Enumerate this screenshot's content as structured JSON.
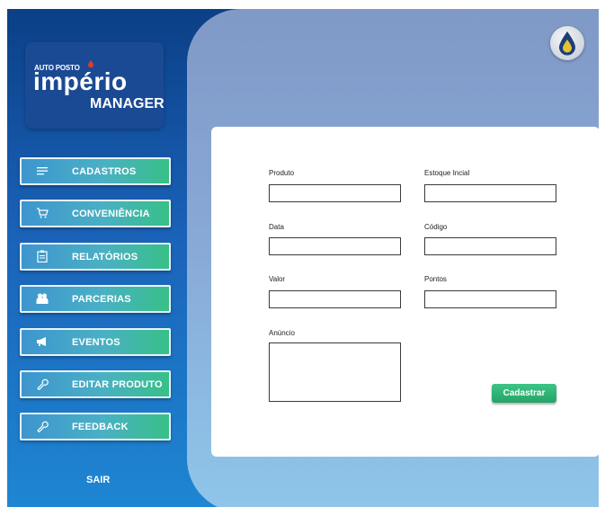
{
  "brand": {
    "logo_top": "AUTO POSTO",
    "logo_main": "império",
    "logo_sub": "MANAGER"
  },
  "sidebar": {
    "items": [
      {
        "label": "CADASTROS",
        "icon": "menu-lines-icon"
      },
      {
        "label": "CONVENIÊNCIA",
        "icon": "cart-icon"
      },
      {
        "label": "RELATÓRIOS",
        "icon": "clipboard-icon"
      },
      {
        "label": "PARCERIAS",
        "icon": "people-icon"
      },
      {
        "label": "EVENTOS",
        "icon": "megaphone-icon"
      },
      {
        "label": "EDITAR PRODUTO",
        "icon": "wrench-icon"
      },
      {
        "label": "FEEDBACK",
        "icon": "wrench-icon"
      }
    ],
    "logout_label": "SAIR"
  },
  "form": {
    "fields": {
      "produto": {
        "label": "Produto",
        "value": ""
      },
      "estoque": {
        "label": "Estoque Incial",
        "value": ""
      },
      "data": {
        "label": "Data",
        "value": ""
      },
      "codigo": {
        "label": "Código",
        "value": ""
      },
      "valor": {
        "label": "Valor",
        "value": ""
      },
      "pontos": {
        "label": "Pontos",
        "value": ""
      },
      "anuncio": {
        "label": "Anúncio",
        "value": ""
      }
    },
    "submit_label": "Cadastrar"
  },
  "colors": {
    "sidebar_top": "#0b3f86",
    "sidebar_bottom": "#1e86d3",
    "button_gradient_start": "#3e95cf",
    "button_gradient_end": "#37c088",
    "submit_green": "#2fb577",
    "logo_drop_red": "#e23b2e",
    "app_icon_drop": "#e3c330"
  }
}
